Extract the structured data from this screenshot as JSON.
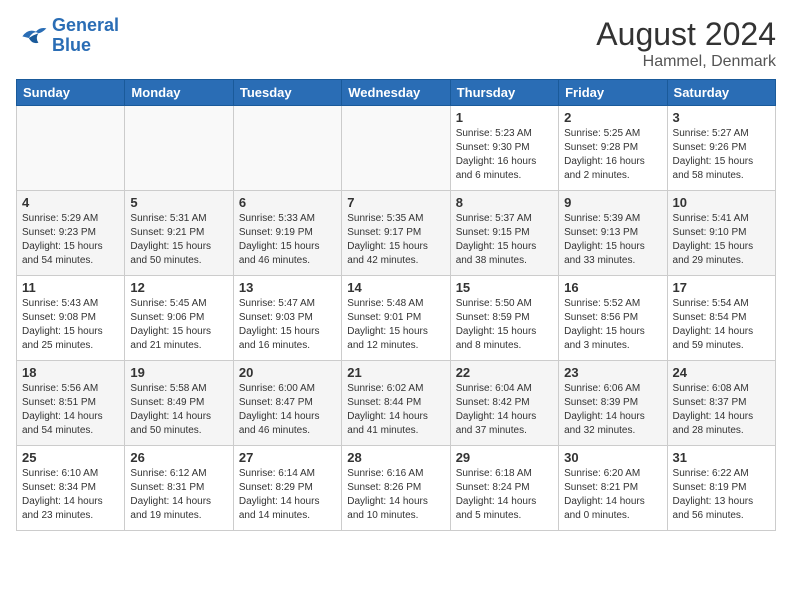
{
  "logo": {
    "line1": "General",
    "line2": "Blue"
  },
  "title": "August 2024",
  "location": "Hammel, Denmark",
  "days_of_week": [
    "Sunday",
    "Monday",
    "Tuesday",
    "Wednesday",
    "Thursday",
    "Friday",
    "Saturday"
  ],
  "weeks": [
    [
      {
        "day": "",
        "info": ""
      },
      {
        "day": "",
        "info": ""
      },
      {
        "day": "",
        "info": ""
      },
      {
        "day": "",
        "info": ""
      },
      {
        "day": "1",
        "info": "Sunrise: 5:23 AM\nSunset: 9:30 PM\nDaylight: 16 hours\nand 6 minutes."
      },
      {
        "day": "2",
        "info": "Sunrise: 5:25 AM\nSunset: 9:28 PM\nDaylight: 16 hours\nand 2 minutes."
      },
      {
        "day": "3",
        "info": "Sunrise: 5:27 AM\nSunset: 9:26 PM\nDaylight: 15 hours\nand 58 minutes."
      }
    ],
    [
      {
        "day": "4",
        "info": "Sunrise: 5:29 AM\nSunset: 9:23 PM\nDaylight: 15 hours\nand 54 minutes."
      },
      {
        "day": "5",
        "info": "Sunrise: 5:31 AM\nSunset: 9:21 PM\nDaylight: 15 hours\nand 50 minutes."
      },
      {
        "day": "6",
        "info": "Sunrise: 5:33 AM\nSunset: 9:19 PM\nDaylight: 15 hours\nand 46 minutes."
      },
      {
        "day": "7",
        "info": "Sunrise: 5:35 AM\nSunset: 9:17 PM\nDaylight: 15 hours\nand 42 minutes."
      },
      {
        "day": "8",
        "info": "Sunrise: 5:37 AM\nSunset: 9:15 PM\nDaylight: 15 hours\nand 38 minutes."
      },
      {
        "day": "9",
        "info": "Sunrise: 5:39 AM\nSunset: 9:13 PM\nDaylight: 15 hours\nand 33 minutes."
      },
      {
        "day": "10",
        "info": "Sunrise: 5:41 AM\nSunset: 9:10 PM\nDaylight: 15 hours\nand 29 minutes."
      }
    ],
    [
      {
        "day": "11",
        "info": "Sunrise: 5:43 AM\nSunset: 9:08 PM\nDaylight: 15 hours\nand 25 minutes."
      },
      {
        "day": "12",
        "info": "Sunrise: 5:45 AM\nSunset: 9:06 PM\nDaylight: 15 hours\nand 21 minutes."
      },
      {
        "day": "13",
        "info": "Sunrise: 5:47 AM\nSunset: 9:03 PM\nDaylight: 15 hours\nand 16 minutes."
      },
      {
        "day": "14",
        "info": "Sunrise: 5:48 AM\nSunset: 9:01 PM\nDaylight: 15 hours\nand 12 minutes."
      },
      {
        "day": "15",
        "info": "Sunrise: 5:50 AM\nSunset: 8:59 PM\nDaylight: 15 hours\nand 8 minutes."
      },
      {
        "day": "16",
        "info": "Sunrise: 5:52 AM\nSunset: 8:56 PM\nDaylight: 15 hours\nand 3 minutes."
      },
      {
        "day": "17",
        "info": "Sunrise: 5:54 AM\nSunset: 8:54 PM\nDaylight: 14 hours\nand 59 minutes."
      }
    ],
    [
      {
        "day": "18",
        "info": "Sunrise: 5:56 AM\nSunset: 8:51 PM\nDaylight: 14 hours\nand 54 minutes."
      },
      {
        "day": "19",
        "info": "Sunrise: 5:58 AM\nSunset: 8:49 PM\nDaylight: 14 hours\nand 50 minutes."
      },
      {
        "day": "20",
        "info": "Sunrise: 6:00 AM\nSunset: 8:47 PM\nDaylight: 14 hours\nand 46 minutes."
      },
      {
        "day": "21",
        "info": "Sunrise: 6:02 AM\nSunset: 8:44 PM\nDaylight: 14 hours\nand 41 minutes."
      },
      {
        "day": "22",
        "info": "Sunrise: 6:04 AM\nSunset: 8:42 PM\nDaylight: 14 hours\nand 37 minutes."
      },
      {
        "day": "23",
        "info": "Sunrise: 6:06 AM\nSunset: 8:39 PM\nDaylight: 14 hours\nand 32 minutes."
      },
      {
        "day": "24",
        "info": "Sunrise: 6:08 AM\nSunset: 8:37 PM\nDaylight: 14 hours\nand 28 minutes."
      }
    ],
    [
      {
        "day": "25",
        "info": "Sunrise: 6:10 AM\nSunset: 8:34 PM\nDaylight: 14 hours\nand 23 minutes."
      },
      {
        "day": "26",
        "info": "Sunrise: 6:12 AM\nSunset: 8:31 PM\nDaylight: 14 hours\nand 19 minutes."
      },
      {
        "day": "27",
        "info": "Sunrise: 6:14 AM\nSunset: 8:29 PM\nDaylight: 14 hours\nand 14 minutes."
      },
      {
        "day": "28",
        "info": "Sunrise: 6:16 AM\nSunset: 8:26 PM\nDaylight: 14 hours\nand 10 minutes."
      },
      {
        "day": "29",
        "info": "Sunrise: 6:18 AM\nSunset: 8:24 PM\nDaylight: 14 hours\nand 5 minutes."
      },
      {
        "day": "30",
        "info": "Sunrise: 6:20 AM\nSunset: 8:21 PM\nDaylight: 14 hours\nand 0 minutes."
      },
      {
        "day": "31",
        "info": "Sunrise: 6:22 AM\nSunset: 8:19 PM\nDaylight: 13 hours\nand 56 minutes."
      }
    ]
  ]
}
